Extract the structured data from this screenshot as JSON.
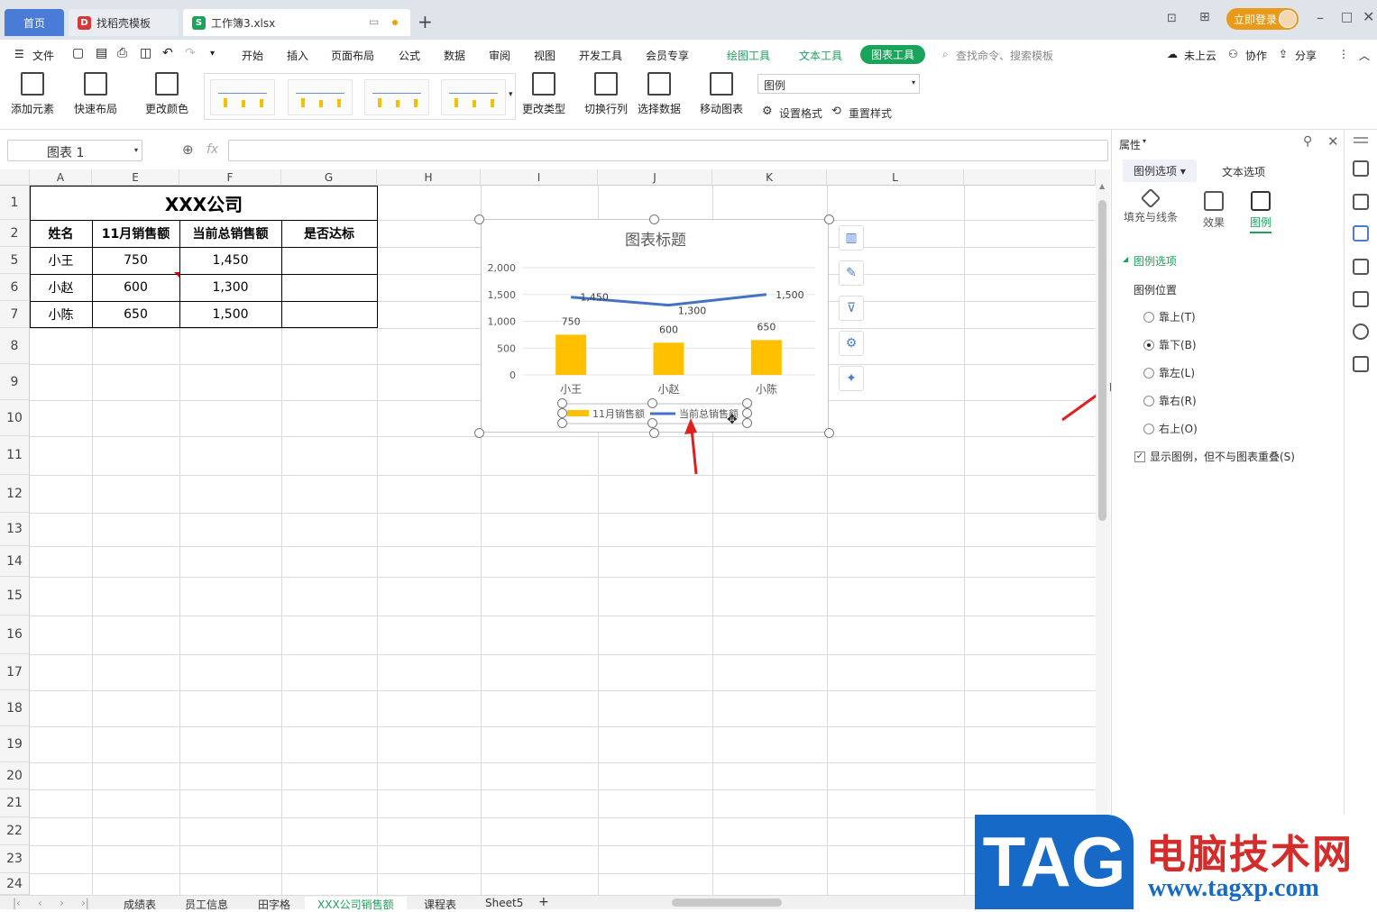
{
  "tabs": {
    "home": "首页",
    "template": "找稻壳模板",
    "file": "工作簿3.xlsx",
    "login": "立即登录"
  },
  "menu": {
    "file": "文件",
    "items": [
      "开始",
      "插入",
      "页面布局",
      "公式",
      "数据",
      "审阅",
      "视图",
      "开发工具",
      "会员专享"
    ],
    "draw_tool": "绘图工具",
    "text_tool": "文本工具",
    "chart_tool": "图表工具",
    "search": "查找命令、搜索模板",
    "cloud": "未上云",
    "collab": "协作",
    "share": "分享"
  },
  "ribbon": {
    "add_element": "添加元素",
    "quick_layout": "快速布局",
    "change_color": "更改颜色",
    "change_type": "更改类型",
    "switch_rowcol": "切换行列",
    "select_data": "选择数据",
    "move_chart": "移动图表",
    "combo_value": "图例",
    "set_format": "设置格式",
    "reset_style": "重置样式"
  },
  "formula": {
    "namebox": "图表  1",
    "fx": "fx"
  },
  "sheet": {
    "columns": [
      "A",
      "E",
      "F",
      "G",
      "H",
      "I",
      "J",
      "K",
      "L"
    ],
    "rows": [
      "1",
      "2",
      "5",
      "6",
      "7",
      "8",
      "9",
      "10",
      "11",
      "12",
      "13",
      "14",
      "15",
      "16",
      "17",
      "18",
      "19",
      "20",
      "21",
      "22",
      "23",
      "24"
    ],
    "title": "XXX公司",
    "headers": [
      "姓名",
      "11月销售额",
      "当前总销售额",
      "是否达标"
    ],
    "data": [
      [
        "小王",
        "750",
        "1,450",
        ""
      ],
      [
        "小赵",
        "600",
        "1,300",
        ""
      ],
      [
        "小陈",
        "650",
        "1,500",
        ""
      ]
    ]
  },
  "chart_data": {
    "type": "bar",
    "title": "图表标题",
    "categories": [
      "小王",
      "小赵",
      "小陈"
    ],
    "series": [
      {
        "name": "11月销售额",
        "kind": "bar",
        "values": [
          750,
          600,
          650
        ],
        "labels": [
          "750",
          "600",
          "650"
        ],
        "color": "#ffc000"
      },
      {
        "name": "当前总销售额",
        "kind": "line",
        "values": [
          1450,
          1300,
          1500
        ],
        "labels": [
          "1,450",
          "1,300",
          "1,500"
        ],
        "color": "#4472c4"
      }
    ],
    "ylim": [
      0,
      2000
    ],
    "yticks": [
      "0",
      "500",
      "1,000",
      "1,500",
      "2,000"
    ],
    "legend": "bottom",
    "grid": true
  },
  "panel": {
    "title": "属性",
    "tab_legend": "图例选项",
    "tab_text": "文本选项",
    "icon_fill": "填充与线条",
    "icon_effect": "效果",
    "icon_legend": "图例",
    "section": "图例选项",
    "position_label": "图例位置",
    "options": [
      "靠上(T)",
      "靠下(B)",
      "靠左(L)",
      "靠右(R)",
      "右上(O)"
    ],
    "selected": "靠下(B)",
    "overlap": "显示图例，但不与图表重叠(S)"
  },
  "sheettabs": [
    "成绩表",
    "员工信息",
    "田字格",
    "XXX公司销售额",
    "课程表",
    "Sheet5"
  ],
  "active_sheet": "XXX公司销售额",
  "watermark": {
    "tag": "TAG",
    "cn": "电脑技术网",
    "url": "www.tagxp.com"
  }
}
